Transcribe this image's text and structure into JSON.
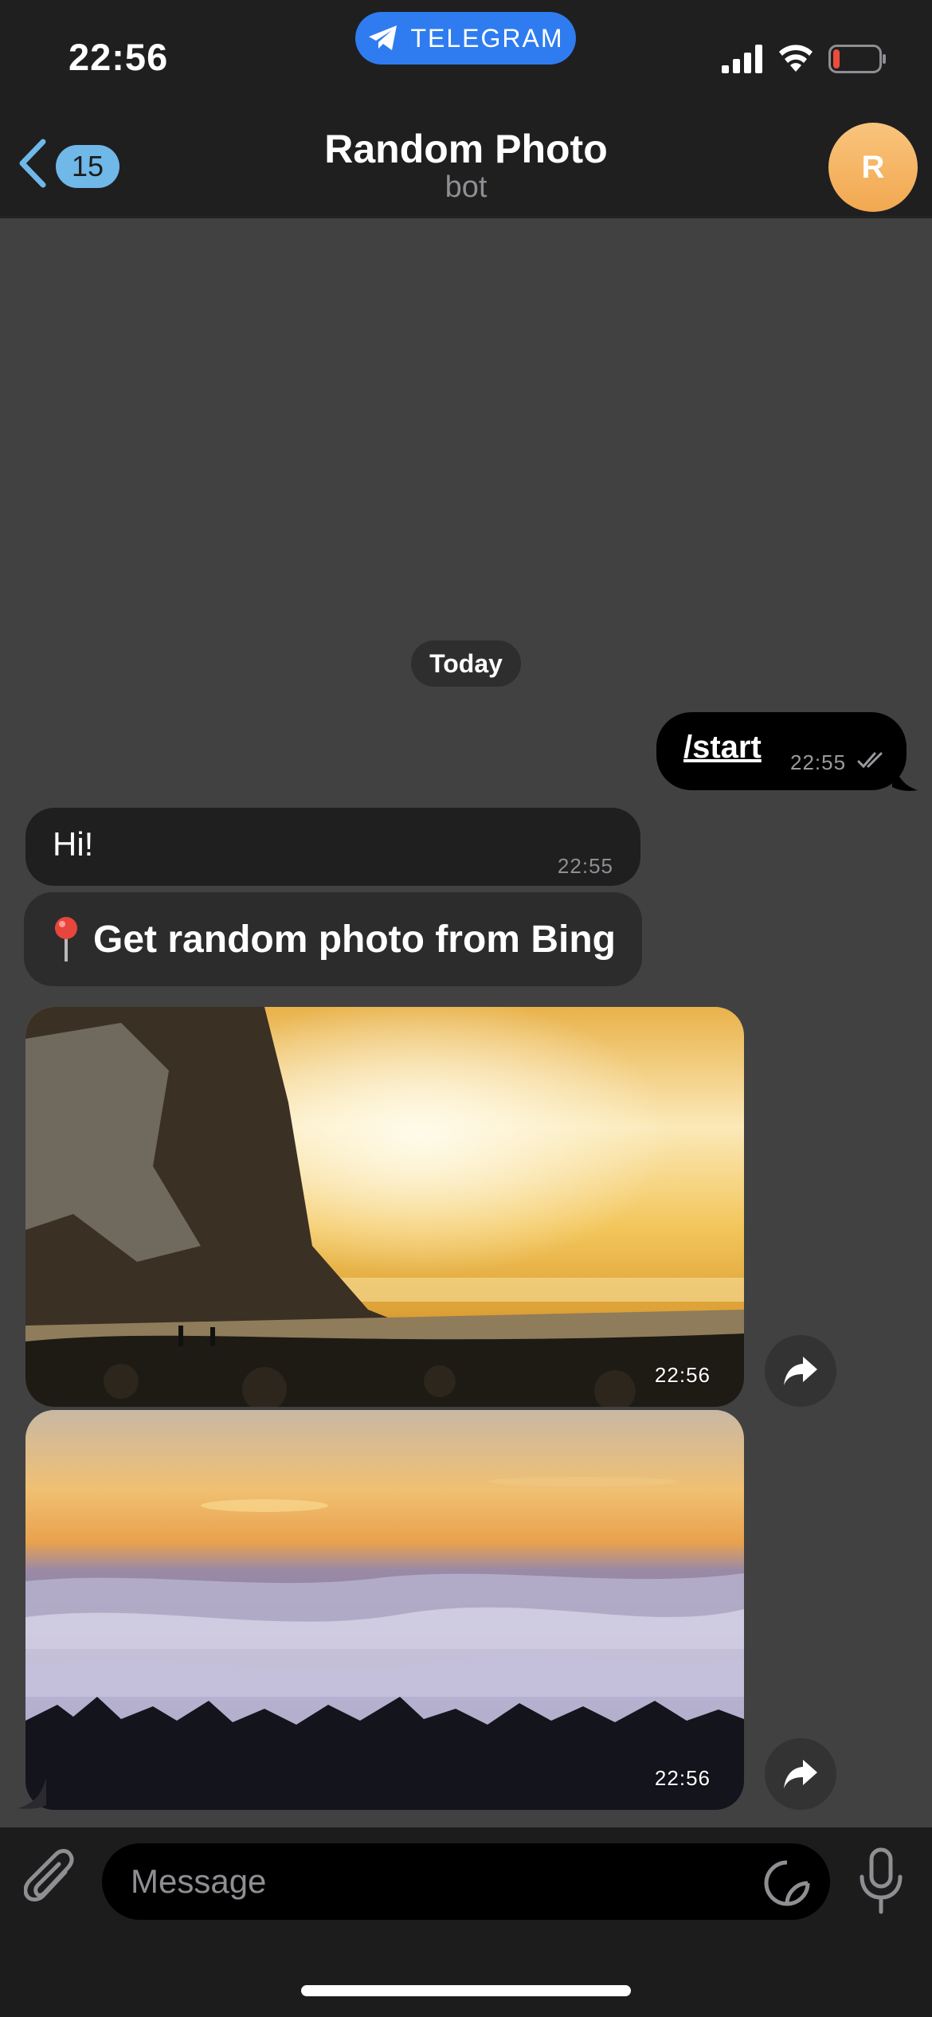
{
  "status_bar": {
    "time": "22:56",
    "pill_label": "TELEGRAM",
    "battery_level": 0.15
  },
  "header": {
    "unread_count": "15",
    "title": "Random Photo",
    "subtitle": "bot",
    "avatar_initial": "R"
  },
  "chat": {
    "date_chip": "Today",
    "messages": [
      {
        "direction": "out",
        "text": "/start",
        "time": "22:55",
        "status": "read"
      },
      {
        "direction": "in",
        "text": "Hi!",
        "time": "22:55"
      }
    ],
    "keyboard_button": {
      "emoji": "📍",
      "label": "Get random photo from Bing"
    },
    "photos": [
      {
        "time": "22:56"
      },
      {
        "time": "22:56"
      }
    ]
  },
  "input": {
    "placeholder": "Message",
    "value": ""
  },
  "colors": {
    "accent": "#2f7cf0",
    "badge": "#6fb8e8",
    "avatar": "#f4b25e",
    "chat_background": "#414142"
  },
  "icons": [
    "telegram-plane-icon",
    "signal-icon",
    "wifi-icon",
    "battery-icon",
    "back-chevron-icon",
    "double-check-icon",
    "pin-icon",
    "share-icon",
    "paperclip-icon",
    "sticker-icon",
    "microphone-icon"
  ]
}
